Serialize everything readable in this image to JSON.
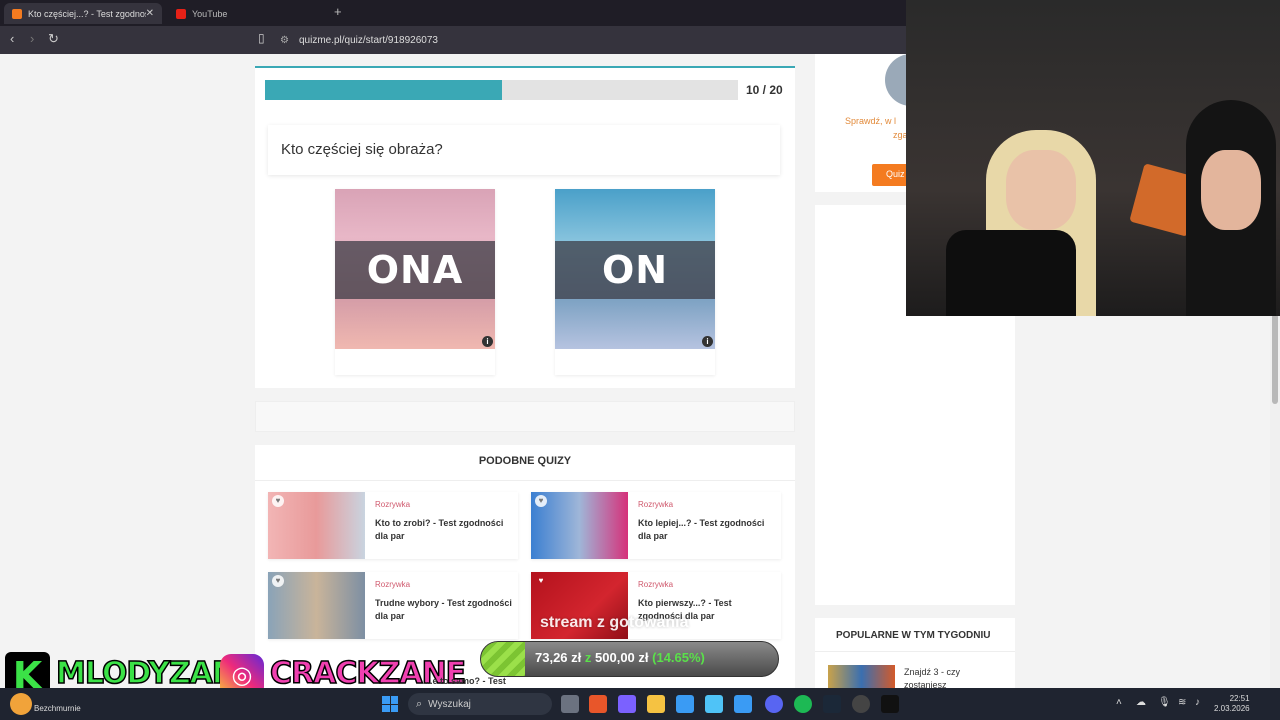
{
  "browser": {
    "tabs": [
      {
        "title": "Kto częściej...? - Test zgodności d",
        "active": true
      },
      {
        "title": "YouTube",
        "active": false
      }
    ],
    "new_tab": "+",
    "url": "quizme.pl/quiz/start/918926073"
  },
  "quiz": {
    "progress_text": "10 / 20",
    "progress_fraction": 0.5,
    "question": "Kto częściej się obraża?",
    "answers": [
      {
        "label": "ONA",
        "info": "i"
      },
      {
        "label": "ON",
        "info": "i"
      }
    ]
  },
  "similar": {
    "heading": "PODOBNE QUIZY",
    "items": [
      {
        "category": "Rozrywka",
        "title": "Kto to zrobi? - Test zgodności dla par"
      },
      {
        "category": "Rozrywka",
        "title": "Kto lepiej...? - Test zgodności dla par"
      },
      {
        "category": "Rozrywka",
        "title": "Trudne wybory - Test zgodności dla par"
      },
      {
        "category": "Rozrywka",
        "title": "Kto pierwszy...? - Test zgodności dla par"
      },
      {
        "category": "",
        "title": "...e to samo? - Test"
      }
    ]
  },
  "sidebar": {
    "check_text": "Sprawdź, w l",
    "check_text_2": "zga",
    "button_label": "Quiz",
    "popular_heading": "POPULARNE W TYM TYGODNIU",
    "popular_item": "Znajdź 3 - czy zostaniesz"
  },
  "overlay": {
    "k_logo": "K",
    "channel1": "MLODYZANE",
    "instagram_icon": "◎",
    "channel2": "CRACKZANE",
    "goal_label": "stream z gotowania",
    "goal_current": "73,26 zł",
    "goal_sep": "z",
    "goal_target": "500,00 zł",
    "goal_percent": "(14.65%)",
    "goal_fraction": 0.1465
  },
  "taskbar": {
    "weather_text": "Bezchmurnie",
    "search_placeholder": "Wyszukaj",
    "time": "22:51",
    "date": "2.03.2026"
  },
  "colors": {
    "accent": "#3aa8b5",
    "category": "#d05a6e",
    "sidebar_button": "#f47b20",
    "overlay_green": "#3be247",
    "overlay_pink": "#f040b0"
  }
}
